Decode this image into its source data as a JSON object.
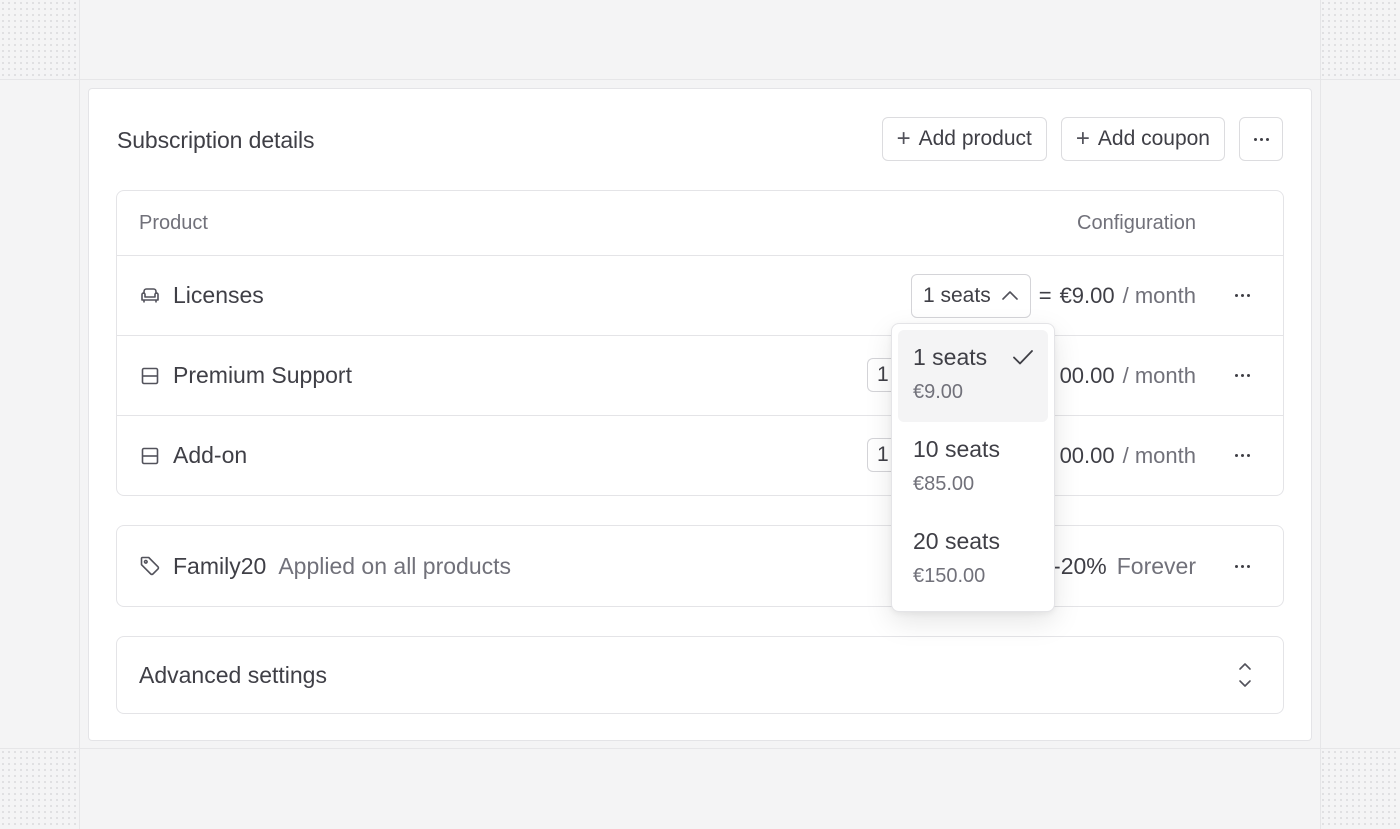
{
  "card": {
    "title": "Subscription details",
    "actions": {
      "add_product": "Add product",
      "add_coupon": "Add coupon",
      "more_icon": "more-horizontal-icon"
    }
  },
  "table": {
    "columns": {
      "product": "Product",
      "configuration": "Configuration"
    },
    "rows": [
      {
        "icon": "armchair-icon",
        "name": "Licenses",
        "quantity": "1 seats",
        "equals": "=",
        "price": "€9.00",
        "period": "/ month"
      },
      {
        "icon": "package-icon",
        "name": "Premium Support",
        "quantity": "1",
        "price": "00.00",
        "period": "/ month"
      },
      {
        "icon": "package-icon",
        "name": "Add-on",
        "quantity": "1",
        "price": "00.00",
        "period": "/ month"
      }
    ]
  },
  "coupon": {
    "icon": "tag-icon",
    "code": "Family20",
    "scope": "Applied on all products",
    "discount": "-20%",
    "duration": "Forever"
  },
  "advanced": {
    "title": "Advanced settings",
    "icon": "chevrons-up-down-icon"
  },
  "dropdown": {
    "options": [
      {
        "label": "1 seats",
        "price": "€9.00",
        "selected": true
      },
      {
        "label": "10 seats",
        "price": "€85.00",
        "selected": false
      },
      {
        "label": "20 seats",
        "price": "€150.00",
        "selected": false
      }
    ]
  }
}
